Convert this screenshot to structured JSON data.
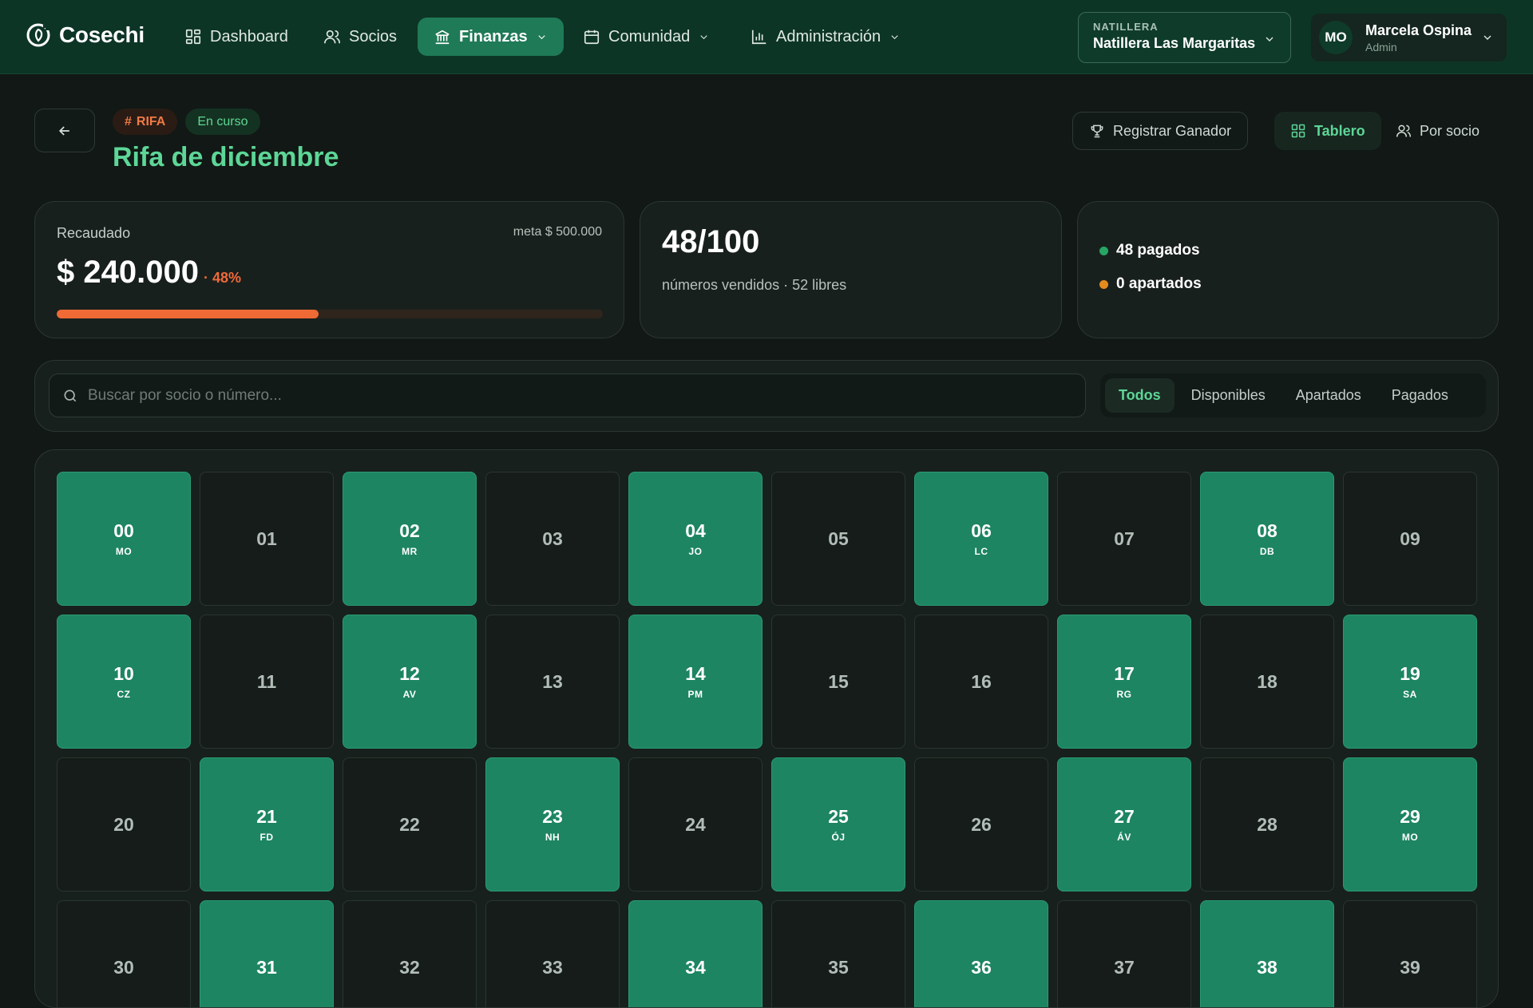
{
  "nav": {
    "brand": "Cosechi",
    "items": [
      {
        "label": "Dashboard",
        "icon": "grid-icon"
      },
      {
        "label": "Socios",
        "icon": "users-icon"
      },
      {
        "label": "Finanzas",
        "icon": "bank-icon",
        "active": true,
        "has_menu": true
      },
      {
        "label": "Comunidad",
        "icon": "calendar-icon",
        "has_menu": true
      },
      {
        "label": "Administración",
        "icon": "bar-chart-icon",
        "has_menu": true
      }
    ],
    "org_label": "NATILLERA",
    "org_value": "Natillera Las Margaritas",
    "user_initials": "MO",
    "user_name": "Marcela Ospina",
    "user_role": "Admin"
  },
  "header": {
    "badge_type": "RIFA",
    "badge_status": "En curso",
    "title": "Rifa de diciembre",
    "register_winner": "Registrar Ganador",
    "view_board": "Tablero",
    "view_member": "Por socio"
  },
  "stats": {
    "collected_label": "Recaudado",
    "goal": "meta $ 500.000",
    "collected": "$ 240.000",
    "percent_label": "· 48%",
    "progress_fraction": 0.48,
    "sold": "48/100",
    "sold_sub": "números vendidos · 52 libres",
    "paid": "48 pagados",
    "reserved": "0 apartados"
  },
  "filters": {
    "search_placeholder": "Buscar por socio o número...",
    "tabs": [
      "Todos",
      "Disponibles",
      "Apartados",
      "Pagados"
    ],
    "active_tab": 0
  },
  "colors": {
    "accent": "#5dd697",
    "paid": "#1d8561",
    "progress": "#ef6a35",
    "paid_dot": "#27a565",
    "reserved_dot": "#e58a1f"
  },
  "numbers": [
    {
      "num": "00",
      "initials": "MO",
      "paid": true
    },
    {
      "num": "01",
      "initials": "",
      "paid": false
    },
    {
      "num": "02",
      "initials": "MR",
      "paid": true
    },
    {
      "num": "03",
      "initials": "",
      "paid": false
    },
    {
      "num": "04",
      "initials": "JO",
      "paid": true
    },
    {
      "num": "05",
      "initials": "",
      "paid": false
    },
    {
      "num": "06",
      "initials": "LC",
      "paid": true
    },
    {
      "num": "07",
      "initials": "",
      "paid": false
    },
    {
      "num": "08",
      "initials": "DB",
      "paid": true
    },
    {
      "num": "09",
      "initials": "",
      "paid": false
    },
    {
      "num": "10",
      "initials": "CZ",
      "paid": true
    },
    {
      "num": "11",
      "initials": "",
      "paid": false
    },
    {
      "num": "12",
      "initials": "AV",
      "paid": true
    },
    {
      "num": "13",
      "initials": "",
      "paid": false
    },
    {
      "num": "14",
      "initials": "PM",
      "paid": true
    },
    {
      "num": "15",
      "initials": "",
      "paid": false
    },
    {
      "num": "16",
      "initials": "",
      "paid": false
    },
    {
      "num": "17",
      "initials": "RG",
      "paid": true
    },
    {
      "num": "18",
      "initials": "",
      "paid": false
    },
    {
      "num": "19",
      "initials": "SA",
      "paid": true
    },
    {
      "num": "20",
      "initials": "",
      "paid": false
    },
    {
      "num": "21",
      "initials": "FD",
      "paid": true
    },
    {
      "num": "22",
      "initials": "",
      "paid": false
    },
    {
      "num": "23",
      "initials": "NH",
      "paid": true
    },
    {
      "num": "24",
      "initials": "",
      "paid": false
    },
    {
      "num": "25",
      "initials": "ÓJ",
      "paid": true
    },
    {
      "num": "26",
      "initials": "",
      "paid": false
    },
    {
      "num": "27",
      "initials": "ÁV",
      "paid": true
    },
    {
      "num": "28",
      "initials": "",
      "paid": false
    },
    {
      "num": "29",
      "initials": "MO",
      "paid": true
    },
    {
      "num": "30",
      "initials": "",
      "paid": false
    },
    {
      "num": "31",
      "initials": "",
      "paid": true
    },
    {
      "num": "32",
      "initials": "",
      "paid": false
    },
    {
      "num": "33",
      "initials": "",
      "paid": false
    },
    {
      "num": "34",
      "initials": "",
      "paid": true
    },
    {
      "num": "35",
      "initials": "",
      "paid": false
    },
    {
      "num": "36",
      "initials": "",
      "paid": true
    },
    {
      "num": "37",
      "initials": "",
      "paid": false
    },
    {
      "num": "38",
      "initials": "",
      "paid": true
    },
    {
      "num": "39",
      "initials": "",
      "paid": false
    }
  ]
}
